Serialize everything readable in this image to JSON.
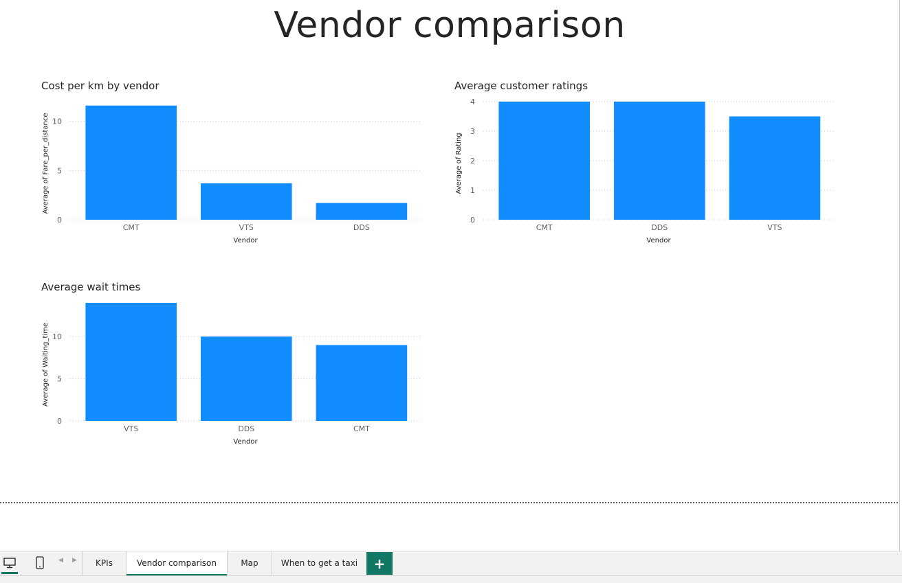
{
  "report": {
    "page_title": "Vendor comparison"
  },
  "visuals": [
    {
      "title": "Cost per km by vendor",
      "chart_data": {
        "type": "bar",
        "title": "Cost per km by vendor",
        "xlabel": "Vendor",
        "ylabel": "Average of Fare_per_distance",
        "categories": [
          "CMT",
          "VTS",
          "DDS"
        ],
        "values": [
          11.6,
          3.7,
          1.7
        ],
        "ylim": [
          0,
          12
        ],
        "yticks": [
          0,
          5,
          10
        ],
        "grid": true,
        "bar_color": "#118DFF"
      }
    },
    {
      "title": "Average customer ratings",
      "chart_data": {
        "type": "bar",
        "title": "Average customer ratings",
        "xlabel": "Vendor",
        "ylabel": "Average of Rating",
        "categories": [
          "CMT",
          "DDS",
          "VTS"
        ],
        "values": [
          4.0,
          4.0,
          3.5
        ],
        "ylim": [
          0,
          4
        ],
        "yticks": [
          0,
          1,
          2,
          3,
          4
        ],
        "grid": true,
        "bar_color": "#118DFF"
      }
    },
    {
      "title": "Average wait times",
      "chart_data": {
        "type": "bar",
        "title": "Average wait times",
        "xlabel": "Vendor",
        "ylabel": "Average of Waiting_time",
        "categories": [
          "VTS",
          "DDS",
          "CMT"
        ],
        "values": [
          14.0,
          10.0,
          9.0
        ],
        "ylim": [
          0,
          14
        ],
        "yticks": [
          0,
          5,
          10
        ],
        "grid": true,
        "bar_color": "#118DFF"
      }
    }
  ],
  "tabbar": {
    "tabs": [
      {
        "label": "KPIs",
        "active": false
      },
      {
        "label": "Vendor comparison",
        "active": true
      },
      {
        "label": "Map",
        "active": false
      },
      {
        "label": "When to get a taxi",
        "active": false
      }
    ],
    "add_label": "+",
    "icons": [
      "desktop-view-icon",
      "mobile-view-icon",
      "chevron-left-icon",
      "chevron-right-icon"
    ]
  },
  "colors": {
    "accent": "#117865",
    "bar": "#118DFF"
  }
}
